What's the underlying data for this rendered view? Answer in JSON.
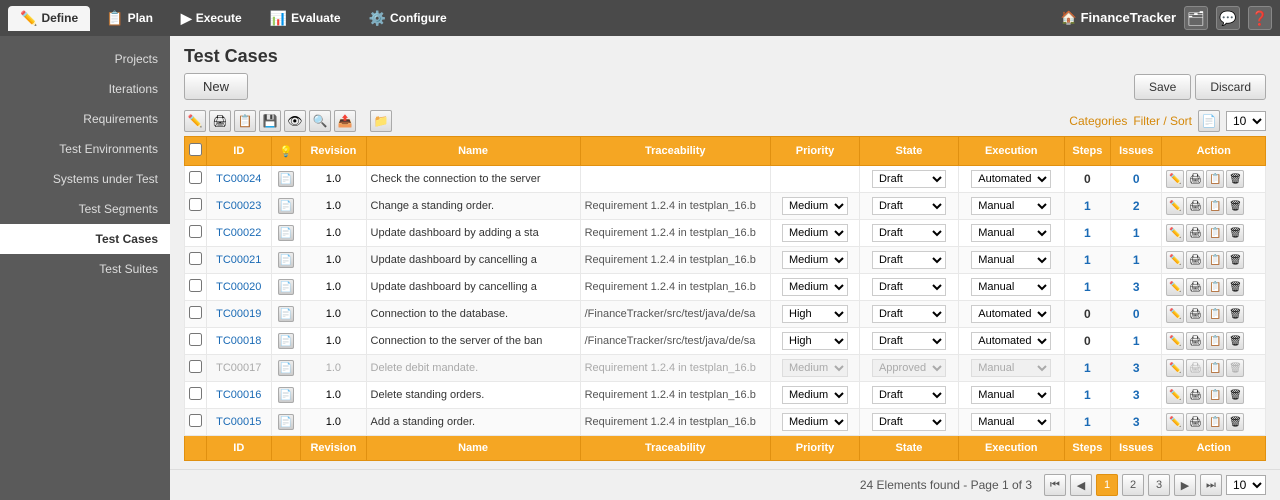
{
  "nav": {
    "tabs": [
      {
        "id": "define",
        "label": "Define",
        "icon": "✏️",
        "active": true
      },
      {
        "id": "plan",
        "label": "Plan",
        "icon": "📋",
        "active": false
      },
      {
        "id": "execute",
        "label": "Execute",
        "icon": "▶️",
        "active": false
      },
      {
        "id": "evaluate",
        "label": "Evaluate",
        "icon": "📊",
        "active": false
      },
      {
        "id": "configure",
        "label": "Configure",
        "icon": "⚙️",
        "active": false
      }
    ],
    "app_name": "FinanceTracker",
    "save_label": "Save",
    "discard_label": "Discard"
  },
  "sidebar": {
    "items": [
      {
        "id": "projects",
        "label": "Projects",
        "active": false
      },
      {
        "id": "iterations",
        "label": "Iterations",
        "active": false
      },
      {
        "id": "requirements",
        "label": "Requirements",
        "active": false
      },
      {
        "id": "test-environments",
        "label": "Test Environments",
        "active": false
      },
      {
        "id": "systems-under-test",
        "label": "Systems under Test",
        "active": false
      },
      {
        "id": "test-segments",
        "label": "Test Segments",
        "active": false
      },
      {
        "id": "test-cases",
        "label": "Test Cases",
        "active": true
      },
      {
        "id": "test-suites",
        "label": "Test Suites",
        "active": false
      }
    ]
  },
  "page": {
    "title": "Test Cases",
    "new_btn": "New",
    "save_btn": "Save",
    "discard_btn": "Discard",
    "categories_label": "Categories",
    "filter_sort_label": "Filter / Sort",
    "page_size": "10",
    "elements_info": "24 Elements found - Page 1 of 3"
  },
  "table": {
    "headers": [
      "ID",
      "",
      "Revision",
      "Name",
      "Traceability",
      "Priority",
      "State",
      "Execution",
      "Steps",
      "Issues",
      "Action"
    ],
    "rows": [
      {
        "id": "TC00024",
        "revision": "1.0",
        "name": "Check the connection to the server",
        "traceability": "",
        "priority": "",
        "state": "Draft",
        "execution": "Automated",
        "steps": "0",
        "issues": "0",
        "greyed": false
      },
      {
        "id": "TC00023",
        "revision": "1.0",
        "name": "Change a standing order.",
        "traceability": "Requirement 1.2.4 in testplan_16.b",
        "priority": "Medium",
        "state": "Draft",
        "execution": "Manual",
        "steps": "1",
        "issues": "2",
        "greyed": false
      },
      {
        "id": "TC00022",
        "revision": "1.0",
        "name": "Update dashboard by adding a sta",
        "traceability": "Requirement 1.2.4 in testplan_16.b",
        "priority": "Medium",
        "state": "Draft",
        "execution": "Manual",
        "steps": "1",
        "issues": "1",
        "greyed": false
      },
      {
        "id": "TC00021",
        "revision": "1.0",
        "name": "Update dashboard by cancelling a",
        "traceability": "Requirement 1.2.4 in testplan_16.b",
        "priority": "Medium",
        "state": "Draft",
        "execution": "Manual",
        "steps": "1",
        "issues": "1",
        "greyed": false
      },
      {
        "id": "TC00020",
        "revision": "1.0",
        "name": "Update dashboard by cancelling a",
        "traceability": "Requirement 1.2.4 in testplan_16.b",
        "priority": "Medium",
        "state": "Draft",
        "execution": "Manual",
        "steps": "1",
        "issues": "3",
        "greyed": false
      },
      {
        "id": "TC00019",
        "revision": "1.0",
        "name": "Connection to the database.",
        "traceability": "/FinanceTracker/src/test/java/de/sa",
        "priority": "High",
        "state": "Draft",
        "execution": "Automated",
        "steps": "0",
        "issues": "0",
        "greyed": false
      },
      {
        "id": "TC00018",
        "revision": "1.0",
        "name": "Connection to the server of the ban",
        "traceability": "/FinanceTracker/src/test/java/de/sa",
        "priority": "High",
        "state": "Draft",
        "execution": "Automated",
        "steps": "0",
        "issues": "1",
        "greyed": false
      },
      {
        "id": "TC00017",
        "revision": "1.0",
        "name": "Delete debit mandate.",
        "traceability": "Requirement 1.2.4 in testplan_16.b",
        "priority": "Medium",
        "state": "Approved",
        "execution": "Manual",
        "steps": "1",
        "issues": "3",
        "greyed": true
      },
      {
        "id": "TC00016",
        "revision": "1.0",
        "name": "Delete standing orders.",
        "traceability": "Requirement 1.2.4 in testplan_16.b",
        "priority": "Medium",
        "state": "Draft",
        "execution": "Manual",
        "steps": "1",
        "issues": "3",
        "greyed": false
      },
      {
        "id": "TC00015",
        "revision": "1.0",
        "name": "Add a standing order.",
        "traceability": "Requirement 1.2.4 in testplan_16.b",
        "priority": "Medium",
        "state": "Draft",
        "execution": "Manual",
        "steps": "1",
        "issues": "3",
        "greyed": false
      }
    ],
    "footer_headers": [
      "ID",
      "",
      "Revision",
      "Name",
      "Traceability",
      "Priority",
      "State",
      "Execution",
      "Steps",
      "Issues",
      "Action"
    ]
  },
  "pagination": {
    "pages": [
      "1",
      "2",
      "3"
    ],
    "current": "1"
  }
}
